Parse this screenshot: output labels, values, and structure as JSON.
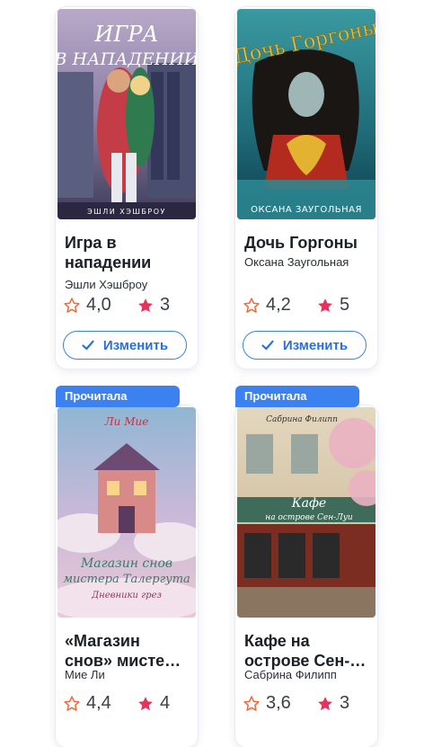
{
  "cards": [
    {
      "cover_text": [
        "ИГРА",
        "В НАПАДЕНИИ"
      ],
      "cover_author": "ЭШЛИ ХЭШБРОУ",
      "title": "Игра в нападении",
      "author": "Эшли Хэшброу",
      "avg_rating": "4,0",
      "my_rating": "3",
      "button_label": "Изменить"
    },
    {
      "cover_text": [
        "Дочь Горгоны"
      ],
      "cover_author": "ОКСАНА ЗАУГОЛЬНАЯ",
      "title": "Дочь Горгоны",
      "author": "Оксана Заугольная",
      "avg_rating": "4,2",
      "my_rating": "5",
      "button_label": "Изменить"
    },
    {
      "badge": "Прочитала",
      "cover_text": [
        "Ли Мие",
        "Магазин снов",
        "мистера Талергута",
        "Дневники грез"
      ],
      "title": "«Магазин снов» мисте…",
      "author": "Мие Ли",
      "avg_rating": "4,4",
      "my_rating": "4"
    },
    {
      "badge": "Прочитала",
      "cover_text": [
        "Сабрина Филипп",
        "Кафе",
        "на острове Сен-Луи"
      ],
      "title": "Кафе на острове Сен-…",
      "author": "Сабрина Филипп",
      "avg_rating": "3,6",
      "my_rating": "3"
    }
  ],
  "colors": {
    "accent": "#3b82f0",
    "star_filled": "#e8315b",
    "star_outline": "#f06a3a"
  },
  "icons": {
    "avg_rating": "star-outline-icon",
    "my_rating": "star-filled-icon",
    "button": "check-icon"
  }
}
